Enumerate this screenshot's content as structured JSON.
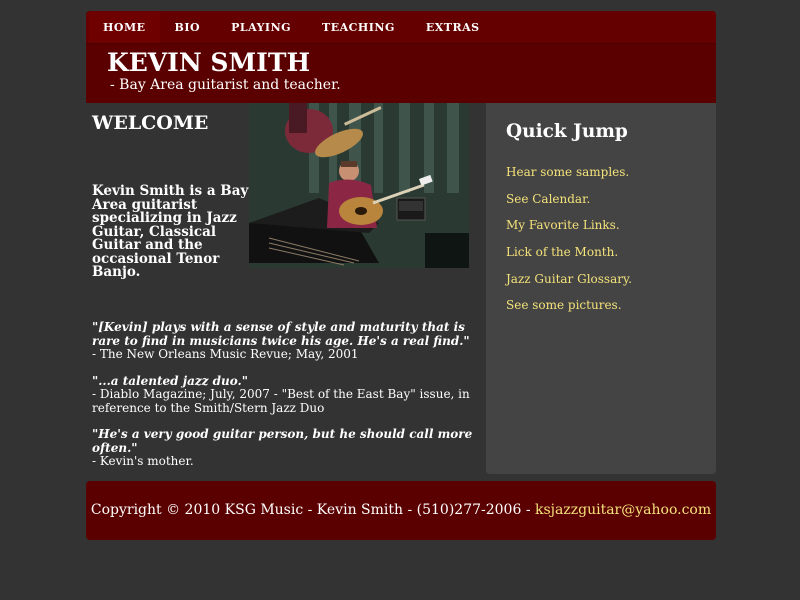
{
  "nav": {
    "items": [
      "HOME",
      "BIO",
      "PLAYING",
      "TEACHING",
      "EXTRAS"
    ]
  },
  "header": {
    "title": "KEVIN SMITH",
    "subtitle": "- Bay Area guitarist and teacher."
  },
  "main": {
    "heading": "WELCOME",
    "intro": "Kevin Smith is a Bay Area guitarist specializing in Jazz Guitar, Classical Guitar and the occasional Tenor Banjo.",
    "quotes": [
      {
        "text": "\"[Kevin] plays with a sense of style and maturity that is rare to find in musicians twice his age. He's a real find.\"",
        "source": "- The New Orleans Music Revue; May, 2001"
      },
      {
        "text": "\"...a talented jazz duo.\"",
        "source": "- Diablo Magazine; July, 2007 - \"Best of the East Bay\" issue, in reference to the Smith/Stern Jazz Duo"
      },
      {
        "text": "\"He's a very good guitar person, but he should call more often.\"",
        "source": "- Kevin's mother."
      }
    ]
  },
  "sidebar": {
    "title": "Quick Jump",
    "links": [
      "Hear some samples.",
      "See Calendar.",
      "My Favorite Links.",
      "Lick of the Month.",
      "Jazz Guitar Glossary.",
      "See some pictures."
    ]
  },
  "footer": {
    "text": "Copyright © 2010 KSG Music - Kevin Smith - (510)277-2006 - ",
    "email": "ksjazzguitar@yahoo.com"
  },
  "colors": {
    "background": "#333333",
    "header_bg": "#5a0000",
    "sidebar_bg": "#444444",
    "link": "#f4e27a"
  }
}
